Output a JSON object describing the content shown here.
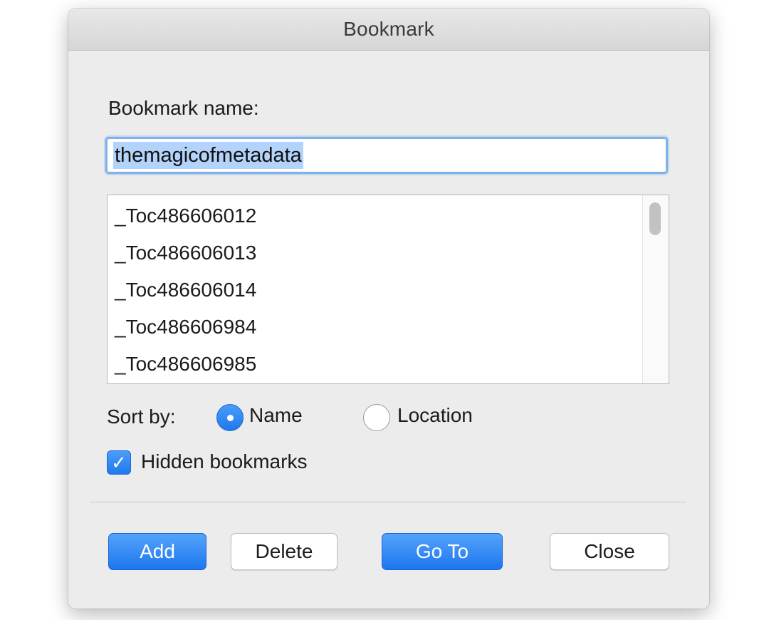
{
  "window": {
    "title": "Bookmark"
  },
  "form": {
    "name_label": "Bookmark name:",
    "name_value": "themagicofmetadata"
  },
  "bookmarks": [
    "_Toc486606012",
    "_Toc486606013",
    "_Toc486606014",
    "_Toc486606984",
    "_Toc486606985"
  ],
  "sort": {
    "label": "Sort by:",
    "options": [
      {
        "label": "Name",
        "selected": true
      },
      {
        "label": "Location",
        "selected": false
      }
    ]
  },
  "hidden_bookmarks": {
    "label": "Hidden bookmarks",
    "checked": true
  },
  "buttons": {
    "add": "Add",
    "delete": "Delete",
    "goto": "Go To",
    "close": "Close"
  },
  "colors": {
    "accent": "#1f79ec",
    "selection": "#b3d3fb",
    "focus_ring": "#7fb1ea"
  }
}
